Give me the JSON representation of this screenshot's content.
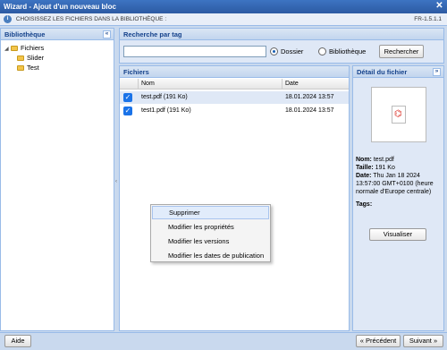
{
  "window": {
    "title": "Wizard - Ajout d'un nouveau bloc",
    "close": "✕"
  },
  "step": {
    "text": "CHOISISSEZ LES FICHIERS DANS LA BIBLIOTHÈQUE :",
    "version": "FR-1.5.1.1",
    "icon_glyph": "i"
  },
  "library": {
    "title": "Bibliothèque",
    "collapse_glyph": "«",
    "tree": [
      {
        "label": "Fichiers",
        "level": 0,
        "expanded": true
      },
      {
        "label": "Slider",
        "level": 1
      },
      {
        "label": "Test",
        "level": 1
      }
    ]
  },
  "search": {
    "title": "Recherche par tag",
    "input_value": "",
    "radio_folder": "Dossier",
    "radio_library": "Bibliothèque",
    "selected": "Dossier",
    "button": "Rechercher"
  },
  "files": {
    "title": "Fichiers",
    "columns": [
      "Nom",
      "Date"
    ],
    "rows": [
      {
        "name": "test.pdf (191 Ko)",
        "date": "18.01.2024 13:57",
        "checked": true
      },
      {
        "name": "test1.pdf (191 Ko)",
        "date": "18.01.2024 13:57",
        "checked": true
      }
    ]
  },
  "context_menu": {
    "items": [
      "Supprimer",
      "Modifier les propriétés",
      "Modifier les versions",
      "Modifier les dates de publication"
    ]
  },
  "detail": {
    "title": "Détail du fichier",
    "expand_glyph": "»",
    "name_label": "Nom:",
    "name_value": "test.pdf",
    "size_label": "Taille:",
    "size_value": "191 Ko",
    "date_label": "Date:",
    "date_value": "Thu Jan 18 2024 13:57:00 GMT+0100 (heure normale d'Europe centrale)",
    "tags_label": "Tags:",
    "view_button": "Visualiser"
  },
  "footer": {
    "help": "Aide",
    "previous": "« Précédent",
    "next": "Suivant »"
  },
  "colors": {
    "header_blue": "#2c5aa3",
    "panel_border": "#99bbe8",
    "checkbox": "#1a73e8"
  }
}
